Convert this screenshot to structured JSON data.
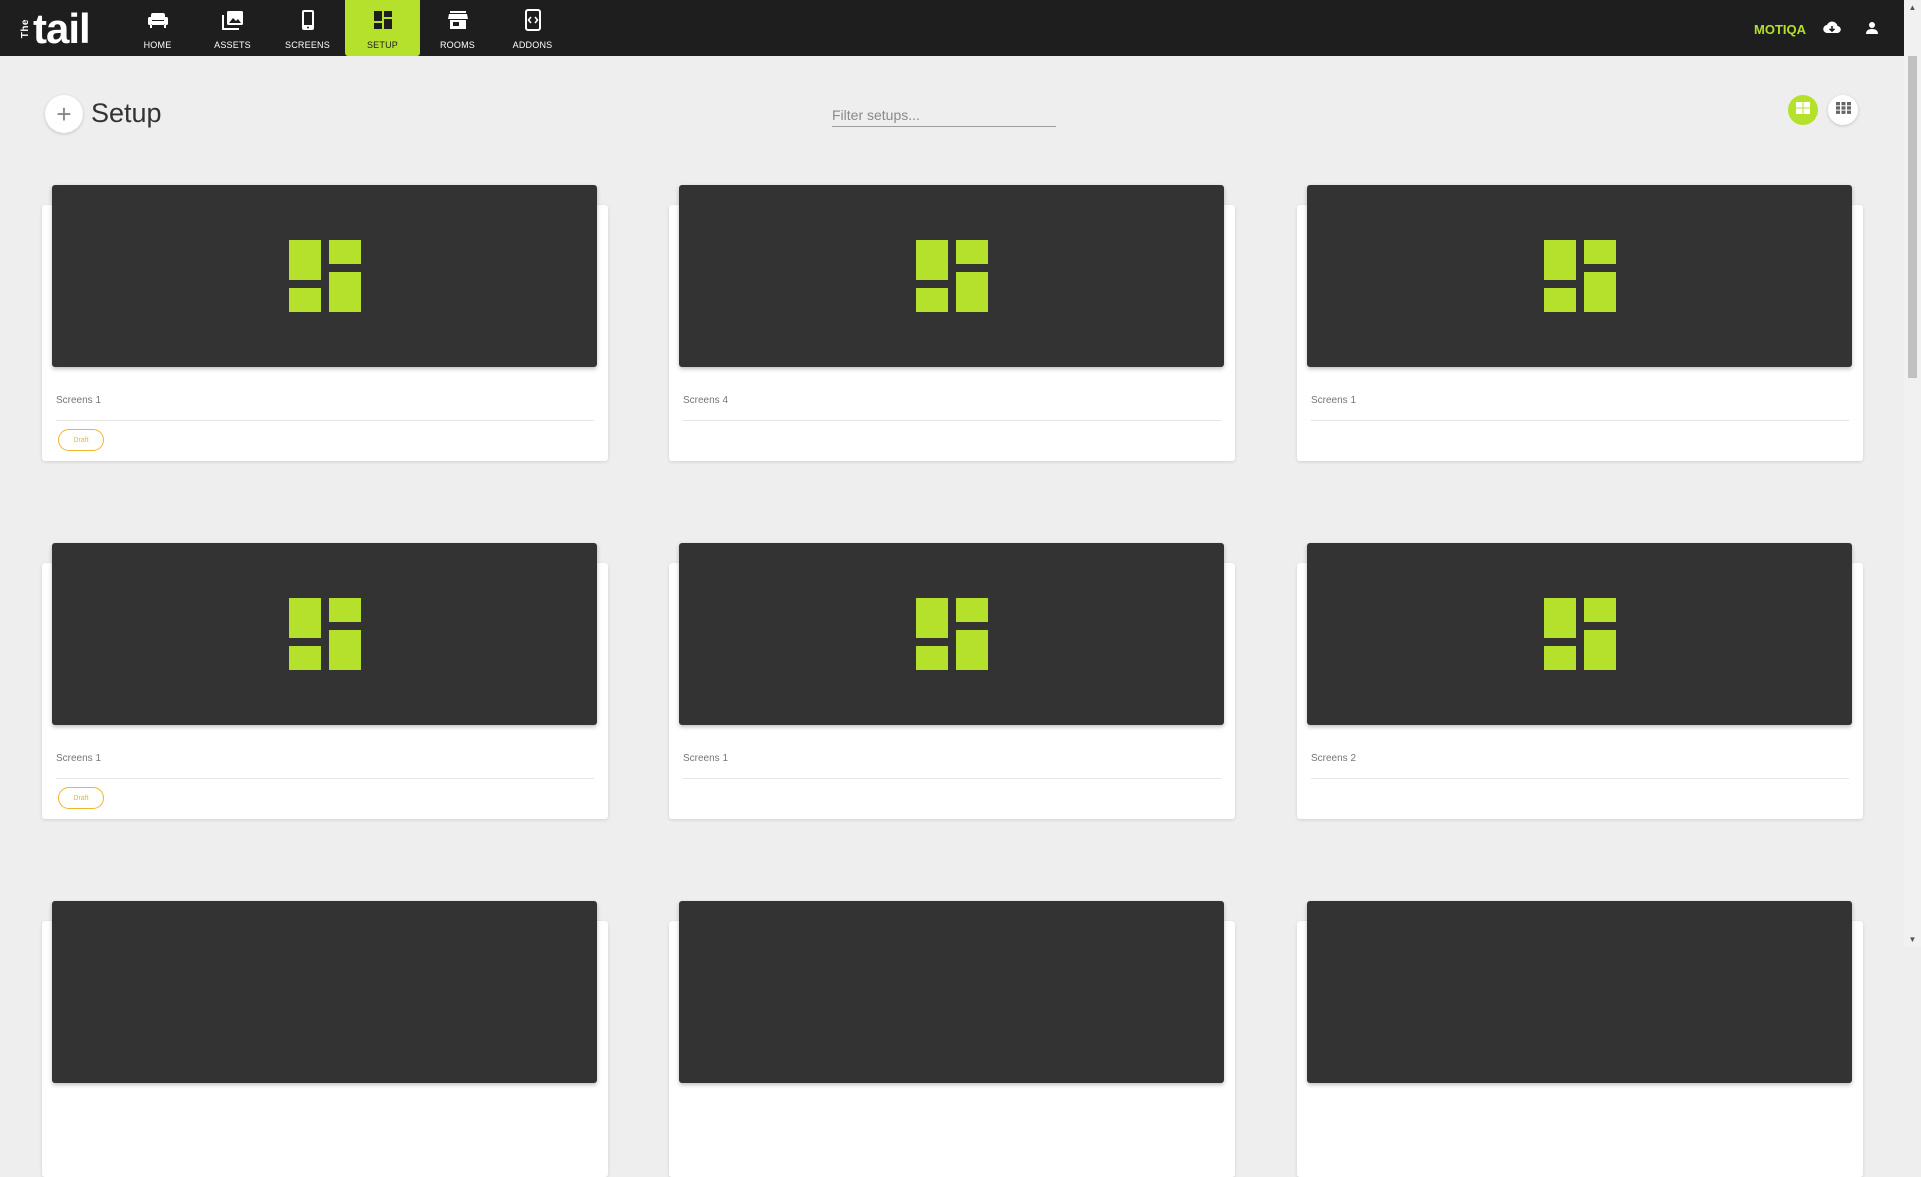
{
  "app": {
    "logo_small": "The",
    "logo_word": "tail"
  },
  "nav": [
    {
      "label": "HOME",
      "icon": "sofa-icon",
      "active": false
    },
    {
      "label": "ASSETS",
      "icon": "photo-library-icon",
      "active": false
    },
    {
      "label": "SCREENS",
      "icon": "phone-icon",
      "active": false
    },
    {
      "label": "SETUP",
      "icon": "dashboard-icon",
      "active": true
    },
    {
      "label": "ROOMS",
      "icon": "store-icon",
      "active": false
    },
    {
      "label": "ADDONS",
      "icon": "code-device-icon",
      "active": false
    }
  ],
  "user": {
    "name": "MOTIQA"
  },
  "header": {
    "title": "Setup",
    "add_symbol": "+"
  },
  "filter": {
    "placeholder": "Filter setups...",
    "value": ""
  },
  "colors": {
    "accent": "#b5e02b",
    "topbar": "#1e1e1e",
    "thumb_bg": "#333333",
    "draft": "#f0b52a"
  },
  "cards": [
    {
      "screens": "Screens 1",
      "badge": "Draft"
    },
    {
      "screens": "Screens 4",
      "badge": ""
    },
    {
      "screens": "Screens 1",
      "badge": ""
    },
    {
      "screens": "Screens 1",
      "badge": "Draft"
    },
    {
      "screens": "Screens 1",
      "badge": ""
    },
    {
      "screens": "Screens 2",
      "badge": ""
    },
    {
      "screens": "",
      "badge": ""
    },
    {
      "screens": "",
      "badge": ""
    },
    {
      "screens": "",
      "badge": ""
    }
  ]
}
